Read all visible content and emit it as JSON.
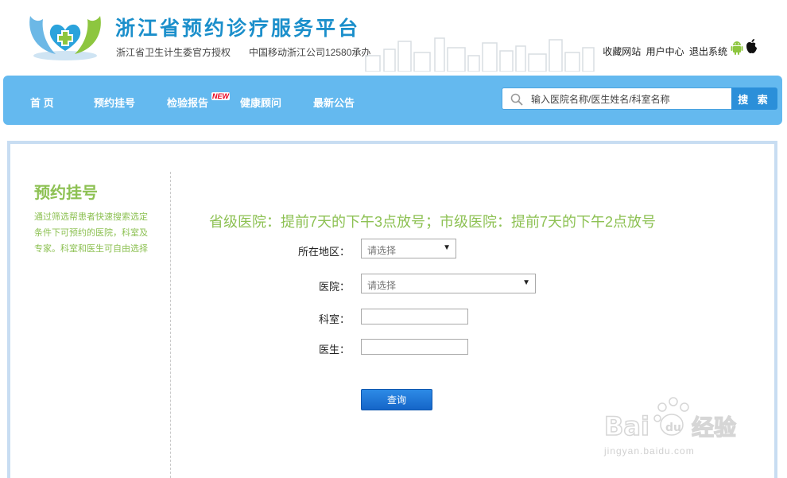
{
  "header": {
    "site_title": "浙江省预约诊疗服务平台",
    "subtitle_left": "浙江省卫生计生委官方授权",
    "subtitle_mid": "中国移动浙江公司12580承办",
    "links": [
      "收藏网站",
      "用户中心",
      "退出系统"
    ],
    "icons": [
      "android-icon",
      "apple-icon"
    ]
  },
  "nav": {
    "items": [
      "首 页",
      "预约挂号",
      "检验报告",
      "健康顾问",
      "最新公告"
    ],
    "new_badge": "NEW",
    "search_placeholder": "输入医院名称/医生姓名/科室名称",
    "search_button": "搜 索"
  },
  "sidebar": {
    "title": "预约挂号",
    "description": "通过筛选帮患者快速搜索选定条件下可预约的医院，科室及专家。科室和医生可自由选择"
  },
  "main": {
    "notice": "省级医院：提前7天的下午3点放号；市级医院：提前7天的下午2点放号",
    "form": {
      "region_label": "所在地区：",
      "region_value": "请选择",
      "hospital_label": "医院：",
      "hospital_value": "请选择",
      "department_label": "科室：",
      "doctor_label": "医生：",
      "query_button": "查询"
    }
  },
  "watermark": {
    "brand": "Bai du 经验",
    "url": "jingyan.baidu.com"
  },
  "colors": {
    "title_blue": "#1b8fcb",
    "nav_blue": "#64b9ef",
    "accent_green": "#8dc153",
    "button_blue": "#1565c8"
  }
}
